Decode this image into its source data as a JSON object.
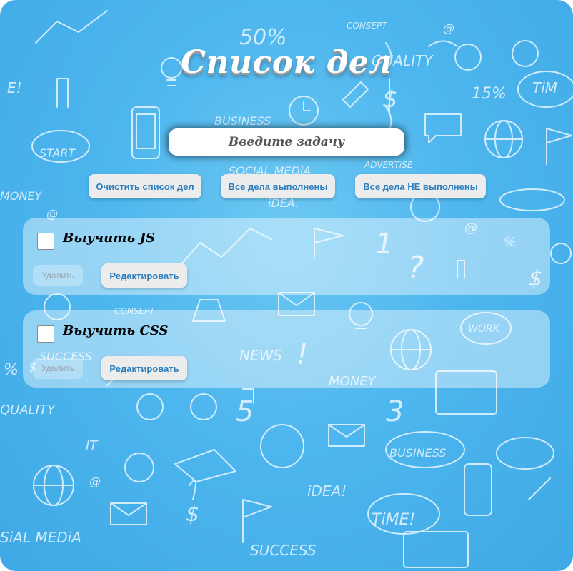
{
  "header": {
    "title": "Список дел"
  },
  "input": {
    "placeholder": "Введите задачу"
  },
  "actions": {
    "clear_label": "Очистить список дел",
    "done_all_label": "Все дела выполнены",
    "undone_all_label": "Все дела НЕ выполнены"
  },
  "tasks": [
    {
      "text": "Выучить JS",
      "checked": false,
      "delete_label": "Удалить",
      "edit_label": "Редактировать"
    },
    {
      "text": "Выучить CSS",
      "checked": false,
      "delete_label": "Удалить",
      "edit_label": "Редактировать"
    }
  ],
  "background": {
    "doodle_texts": [
      "50%",
      "15%",
      "QUALITY",
      "START",
      "MONEY",
      "SUCCESS",
      "NEWS",
      "iDEA!",
      "TiME!",
      "BUSINESS",
      "WORK",
      "IT",
      "SOCIAL MEDIA",
      "ADVERTISE",
      "CONSEPT"
    ]
  },
  "colors": {
    "background": "#4db6ee",
    "button_text": "#2c7fbf",
    "title": "#ffffff"
  }
}
